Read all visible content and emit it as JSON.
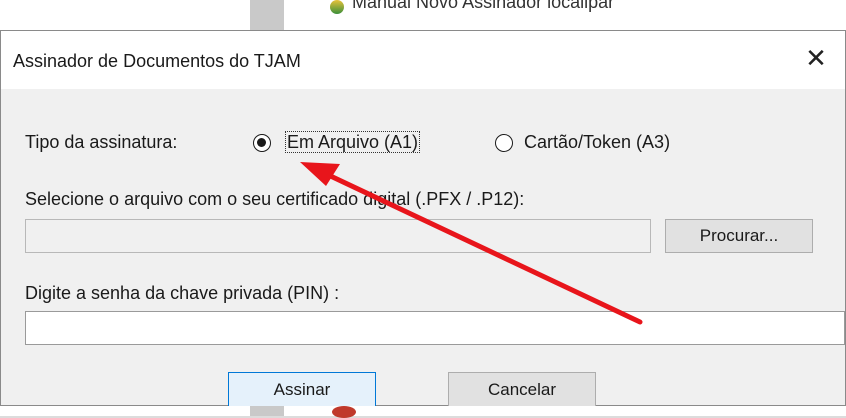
{
  "background": {
    "behind_text": "Manual Novo Assinador localipar"
  },
  "dialog": {
    "title": "Assinador de Documentos do TJAM",
    "close_glyph": "✕",
    "signature_type_label": "Tipo da assinatura:",
    "option_a1": "Em Arquivo (A1)",
    "option_a3": "Cartão/Token (A3)",
    "selected_option": "option_a1",
    "file_label": "Selecione o arquivo com o seu certificado digital (.PFX / .P12):",
    "file_path_value": "",
    "browse_label": "Procurar...",
    "pin_label": "Digite a senha da chave privada (PIN) :",
    "pin_value": "",
    "sign_label": "Assinar",
    "cancel_label": "Cancelar"
  },
  "colors": {
    "annotation_arrow": "#e8151b",
    "default_button_border": "#0078d7"
  }
}
